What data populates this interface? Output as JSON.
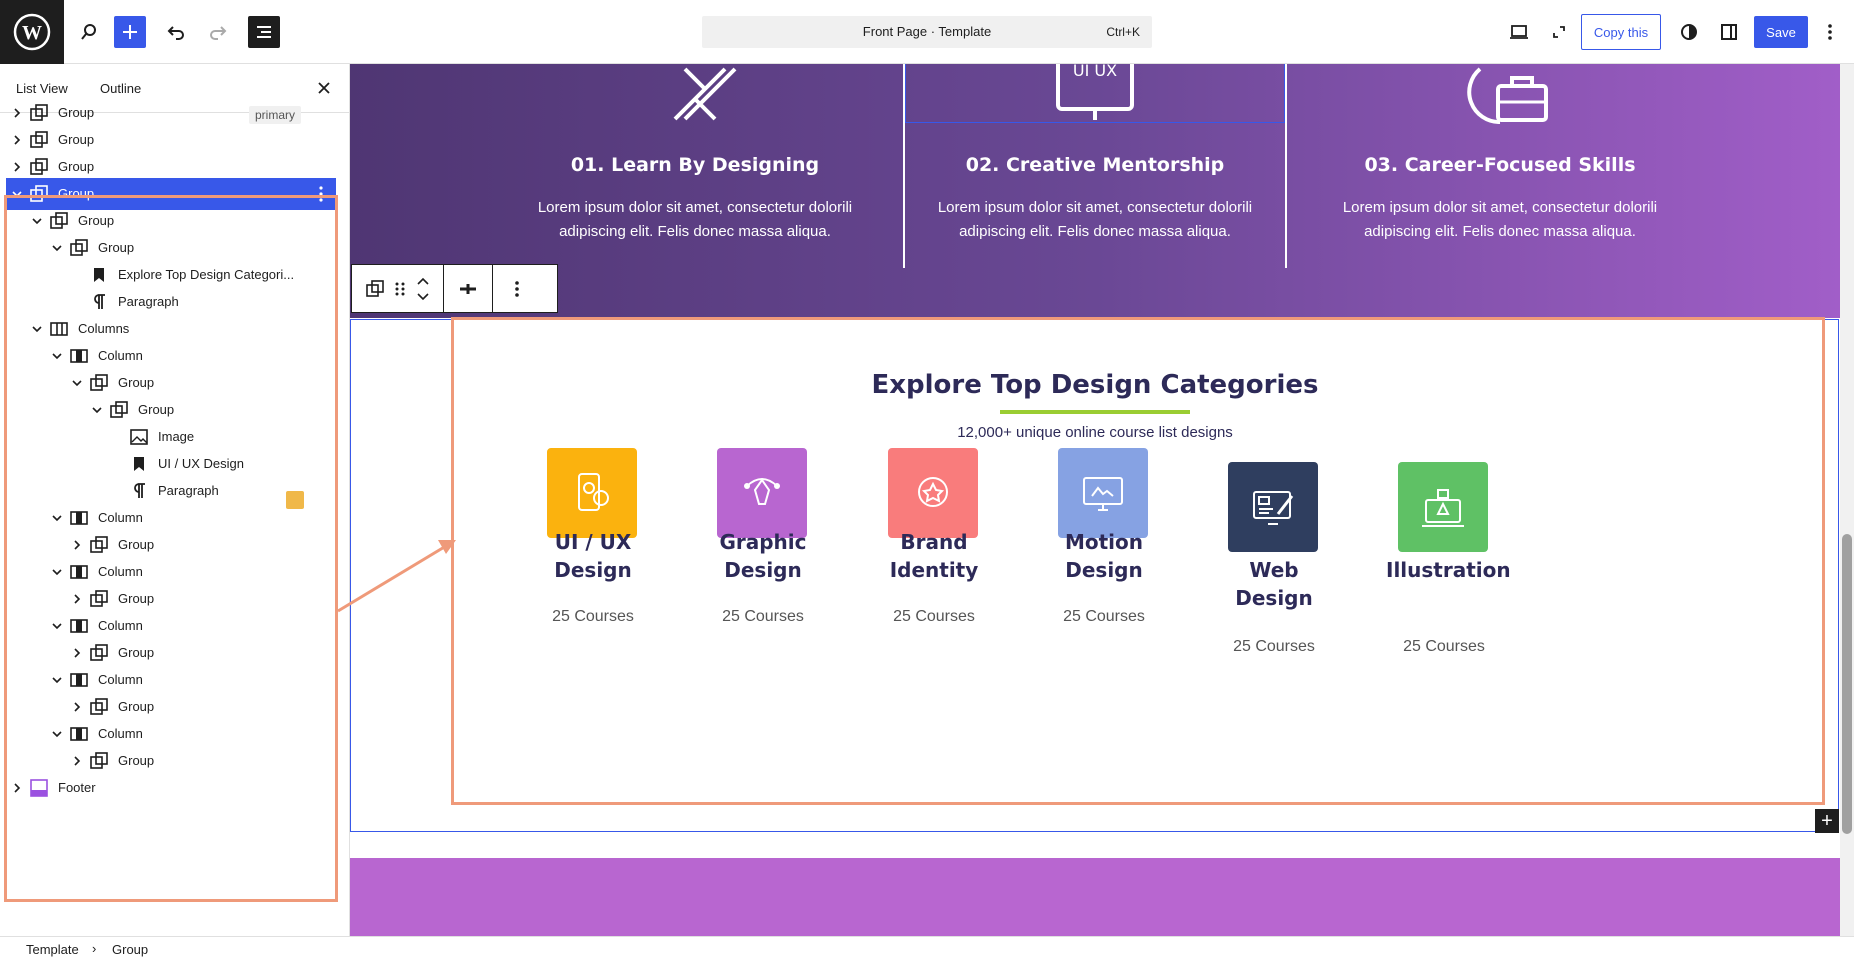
{
  "topbar": {
    "doc_title": "Front Page · Template",
    "doc_shortcut": "Ctrl+K",
    "copy_label": "Copy this",
    "save_label": "Save"
  },
  "sidebar": {
    "tabs": [
      "List View",
      "Outline"
    ],
    "badge": "primary",
    "rows": [
      {
        "label": "Group"
      },
      {
        "label": "Group"
      },
      {
        "label": "Group"
      },
      {
        "label": "Group"
      },
      {
        "label": "Group"
      },
      {
        "label": "Group"
      },
      {
        "label": "Explore Top Design Categori..."
      },
      {
        "label": "Paragraph"
      },
      {
        "label": "Columns"
      },
      {
        "label": "Column"
      },
      {
        "label": "Group"
      },
      {
        "label": "Group"
      },
      {
        "label": "Image"
      },
      {
        "label": "UI / UX Design"
      },
      {
        "label": "Paragraph"
      },
      {
        "label": "Column"
      },
      {
        "label": "Group"
      },
      {
        "label": "Column"
      },
      {
        "label": "Group"
      },
      {
        "label": "Column"
      },
      {
        "label": "Group"
      },
      {
        "label": "Column"
      },
      {
        "label": "Group"
      },
      {
        "label": "Column"
      },
      {
        "label": "Group"
      },
      {
        "label": "Footer"
      }
    ]
  },
  "hero": {
    "features": [
      {
        "title": "01. Learn By Designing",
        "text": "Lorem ipsum dolor sit amet, consectetur dolorili adipiscing elit. Felis donec massa aliqua."
      },
      {
        "title": "02. Creative Mentorship",
        "text": "Lorem ipsum dolor sit amet, consectetur dolorili adipiscing elit. Felis donec massa aliqua."
      },
      {
        "title": "03. Career-Focused Skills",
        "text": "Lorem ipsum dolor sit amet, consectetur dolorili adipiscing elit. Felis donec massa aliqua."
      }
    ]
  },
  "categories": {
    "title": "Explore Top Design Categories",
    "subtitle": "12,000+ unique online course list designs",
    "items": [
      {
        "name": "UI / UX Design",
        "count": "25 Courses",
        "color": "#fbb20e"
      },
      {
        "name": "Graphic Design",
        "count": "25 Courses",
        "color": "#b866d0"
      },
      {
        "name": "Brand Identity",
        "count": "25 Courses",
        "color": "#f97c7c"
      },
      {
        "name": "Motion Design",
        "count": "25 Courses",
        "color": "#86a2e3"
      },
      {
        "name": "Web Design",
        "count": "25 Courses",
        "color": "#2f3e5f"
      },
      {
        "name": "Illustration",
        "count": "25 Courses",
        "color": "#5fc165"
      }
    ]
  },
  "breadcrumb": [
    "Template",
    "Group"
  ]
}
